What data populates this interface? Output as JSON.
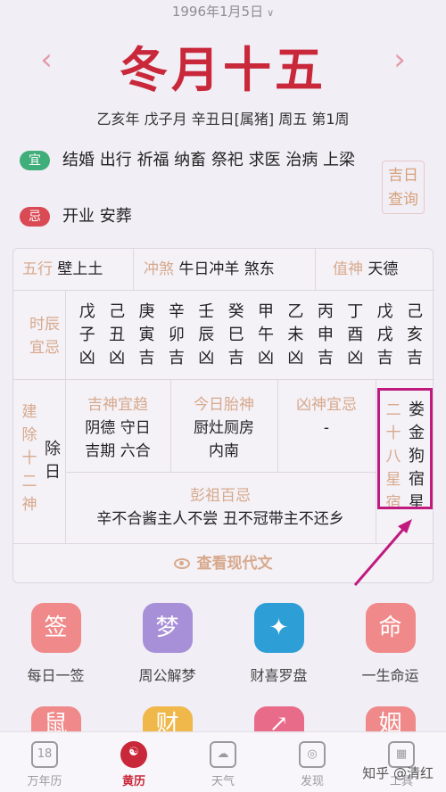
{
  "header": {
    "solar_date": "1996年1月5日",
    "lunar_date": "冬月十五",
    "ganzhi": "乙亥年 戊子月 辛丑日[属猪] 周五 第1周"
  },
  "yiji": {
    "yi_badge": "宜",
    "yi_text": "结婚 出行 祈福 纳畜 祭祀 求医 治病 上梁",
    "ji_badge": "忌",
    "ji_text": "开业 安葬",
    "jiri_button": "吉日查询"
  },
  "row1": {
    "wuxing_label": "五行",
    "wuxing_value": "壁上土",
    "chongsha_label": "冲煞",
    "chongsha_value": "牛日冲羊 煞东",
    "zhishen_label": "值神",
    "zhishen_value": "天德"
  },
  "shichen": {
    "label": "时辰宜忌",
    "columns": [
      {
        "gan": "戊",
        "zhi": "子",
        "luck": "凶"
      },
      {
        "gan": "己",
        "zhi": "丑",
        "luck": "凶"
      },
      {
        "gan": "庚",
        "zhi": "寅",
        "luck": "吉"
      },
      {
        "gan": "辛",
        "zhi": "卯",
        "luck": "吉"
      },
      {
        "gan": "壬",
        "zhi": "辰",
        "luck": "凶"
      },
      {
        "gan": "癸",
        "zhi": "巳",
        "luck": "吉"
      },
      {
        "gan": "甲",
        "zhi": "午",
        "luck": "凶"
      },
      {
        "gan": "乙",
        "zhi": "未",
        "luck": "凶"
      },
      {
        "gan": "丙",
        "zhi": "申",
        "luck": "吉"
      },
      {
        "gan": "丁",
        "zhi": "酉",
        "luck": "凶"
      },
      {
        "gan": "戊",
        "zhi": "戌",
        "luck": "吉"
      },
      {
        "gan": "己",
        "zhi": "亥",
        "luck": "吉"
      }
    ]
  },
  "jianchu": {
    "label": "建除十二神",
    "value": "除日"
  },
  "jishen": {
    "title": "吉神宜趋",
    "line1": "阴德 守日",
    "line2": "吉期 六合"
  },
  "taishen": {
    "title": "今日胎神",
    "line1": "厨灶厕房",
    "line2": "内南"
  },
  "xiongshen": {
    "title": "凶神宜忌",
    "value": "-"
  },
  "xingxiu": {
    "label": "二十八星宿",
    "value": "娄金狗宿星"
  },
  "pengzu": {
    "title": "彭祖百忌",
    "text": "辛不合酱主人不尝 丑不冠带主不还乡"
  },
  "modern_link": "查看现代文",
  "apps": [
    {
      "icon_char": "签",
      "label": "每日一签",
      "color": "#f08a8a"
    },
    {
      "icon_char": "梦",
      "label": "周公解梦",
      "color": "#a790d8"
    },
    {
      "icon_char": "✦",
      "label": "财喜罗盘",
      "color": "#2e9fd6"
    },
    {
      "icon_char": "命",
      "label": "一生命运",
      "color": "#f08a8a"
    }
  ],
  "apps_row2": [
    {
      "icon_char": "鼠",
      "color": "#f08a8a"
    },
    {
      "icon_char": "财",
      "color": "#f0b84a"
    },
    {
      "icon_char": "↗",
      "color": "#e86b8a"
    },
    {
      "icon_char": "姻",
      "color": "#f08a8a"
    }
  ],
  "tabs": [
    {
      "icon": "18",
      "label": "万年历"
    },
    {
      "icon": "☯",
      "label": "黄历"
    },
    {
      "icon": "☁",
      "label": "天气"
    },
    {
      "icon": "◎",
      "label": "发现"
    },
    {
      "icon": "▦",
      "label": "工具"
    }
  ],
  "watermark": "知乎 @清红"
}
